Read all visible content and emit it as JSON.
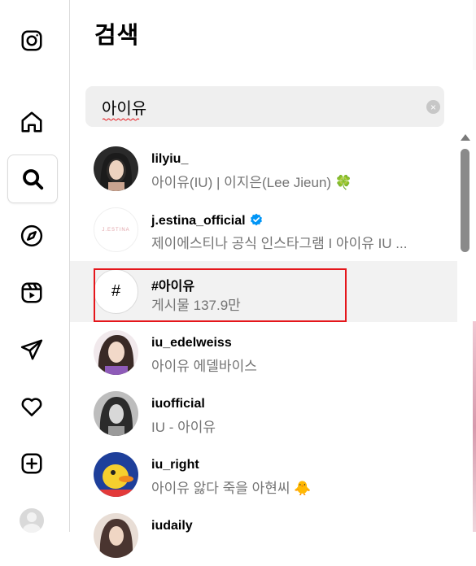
{
  "panel": {
    "title": "검색",
    "search": {
      "value": "아이유",
      "clear_glyph": "×"
    }
  },
  "results": [
    {
      "username": "lilyiu_",
      "subtitle": "아이유(IU) | 이지은(Lee Jieun) 🍀",
      "verified": false,
      "kind": "user"
    },
    {
      "username": "j.estina_official",
      "subtitle": "제이에스티나 공식 인스타그램 I 아이유 IU ...",
      "verified": true,
      "kind": "user",
      "avatar_text": "J.ESTINA"
    },
    {
      "username": "#아이유",
      "subtitle": "게시물 137.9만",
      "verified": false,
      "kind": "hashtag",
      "avatar_text": "#"
    },
    {
      "username": "iu_edelweiss",
      "subtitle": "아이유 에델바이스",
      "verified": false,
      "kind": "user"
    },
    {
      "username": "iuofficial",
      "subtitle": "IU - 아이유",
      "verified": false,
      "kind": "user"
    },
    {
      "username": "iu_right",
      "subtitle": "아이유 앓다 죽을 아현씨 🐥",
      "verified": false,
      "kind": "user"
    },
    {
      "username": "iudaily",
      "subtitle": "",
      "verified": false,
      "kind": "user"
    }
  ],
  "nav": [
    "instagram-logo-icon",
    "home-icon",
    "search-icon",
    "explore-icon",
    "reels-icon",
    "messages-icon",
    "notifications-icon",
    "create-icon",
    "profile-avatar"
  ],
  "colors": {
    "highlight": "#e5161b",
    "verified": "#0095f6",
    "secondary_text": "#737373"
  }
}
